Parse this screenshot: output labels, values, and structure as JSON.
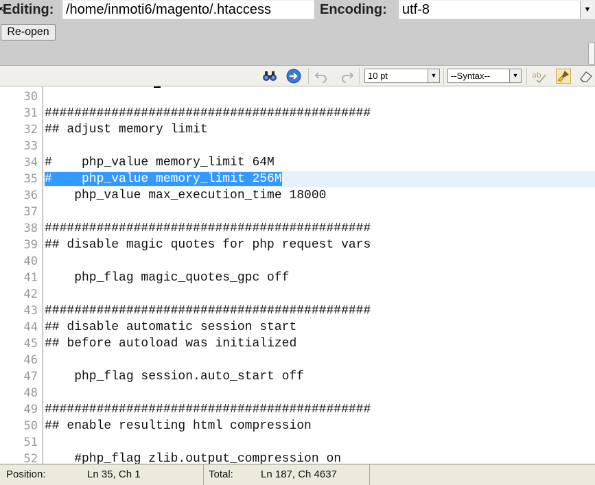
{
  "header": {
    "editing_label": "Editing:",
    "file_path": "/home/inmoti6/magento/.htaccess",
    "encoding_label": "Encoding:",
    "encoding_value": "utf-8",
    "reopen_label": "Re-open"
  },
  "toolbar": {
    "icons": [
      "find-icon",
      "goto-icon",
      "undo-icon",
      "redo-icon",
      "spellcheck-icon",
      "highlight-brush-icon",
      "eraser-icon"
    ],
    "font_size": "10 pt",
    "syntax": "--Syntax--"
  },
  "editor": {
    "lines": [
      {
        "num": "30",
        "text": ""
      },
      {
        "num": "31",
        "text": "############################################"
      },
      {
        "num": "32",
        "text": "## adjust memory limit"
      },
      {
        "num": "33",
        "text": ""
      },
      {
        "num": "34",
        "text": "#    php_value memory_limit 64M"
      },
      {
        "num": "35",
        "text": "#    php_value memory_limit 256M"
      },
      {
        "num": "36",
        "text": "    php_value max_execution_time 18000"
      },
      {
        "num": "37",
        "text": ""
      },
      {
        "num": "38",
        "text": "############################################"
      },
      {
        "num": "39",
        "text": "## disable magic quotes for php request vars"
      },
      {
        "num": "40",
        "text": ""
      },
      {
        "num": "41",
        "text": "    php_flag magic_quotes_gpc off"
      },
      {
        "num": "42",
        "text": ""
      },
      {
        "num": "43",
        "text": "############################################"
      },
      {
        "num": "44",
        "text": "## disable automatic session start"
      },
      {
        "num": "45",
        "text": "## before autoload was initialized"
      },
      {
        "num": "46",
        "text": ""
      },
      {
        "num": "47",
        "text": "    php_flag session.auto_start off"
      },
      {
        "num": "48",
        "text": ""
      },
      {
        "num": "49",
        "text": "############################################"
      },
      {
        "num": "50",
        "text": "## enable resulting html compression"
      },
      {
        "num": "51",
        "text": ""
      },
      {
        "num": "52",
        "text": "    #php_flag zlib.output_compression on"
      }
    ],
    "current_line": "35"
  },
  "status": {
    "position_label": "Position:",
    "position_value": "Ln 35, Ch 1",
    "total_label": "Total:",
    "total_value": "Ln 187, Ch 4637"
  }
}
